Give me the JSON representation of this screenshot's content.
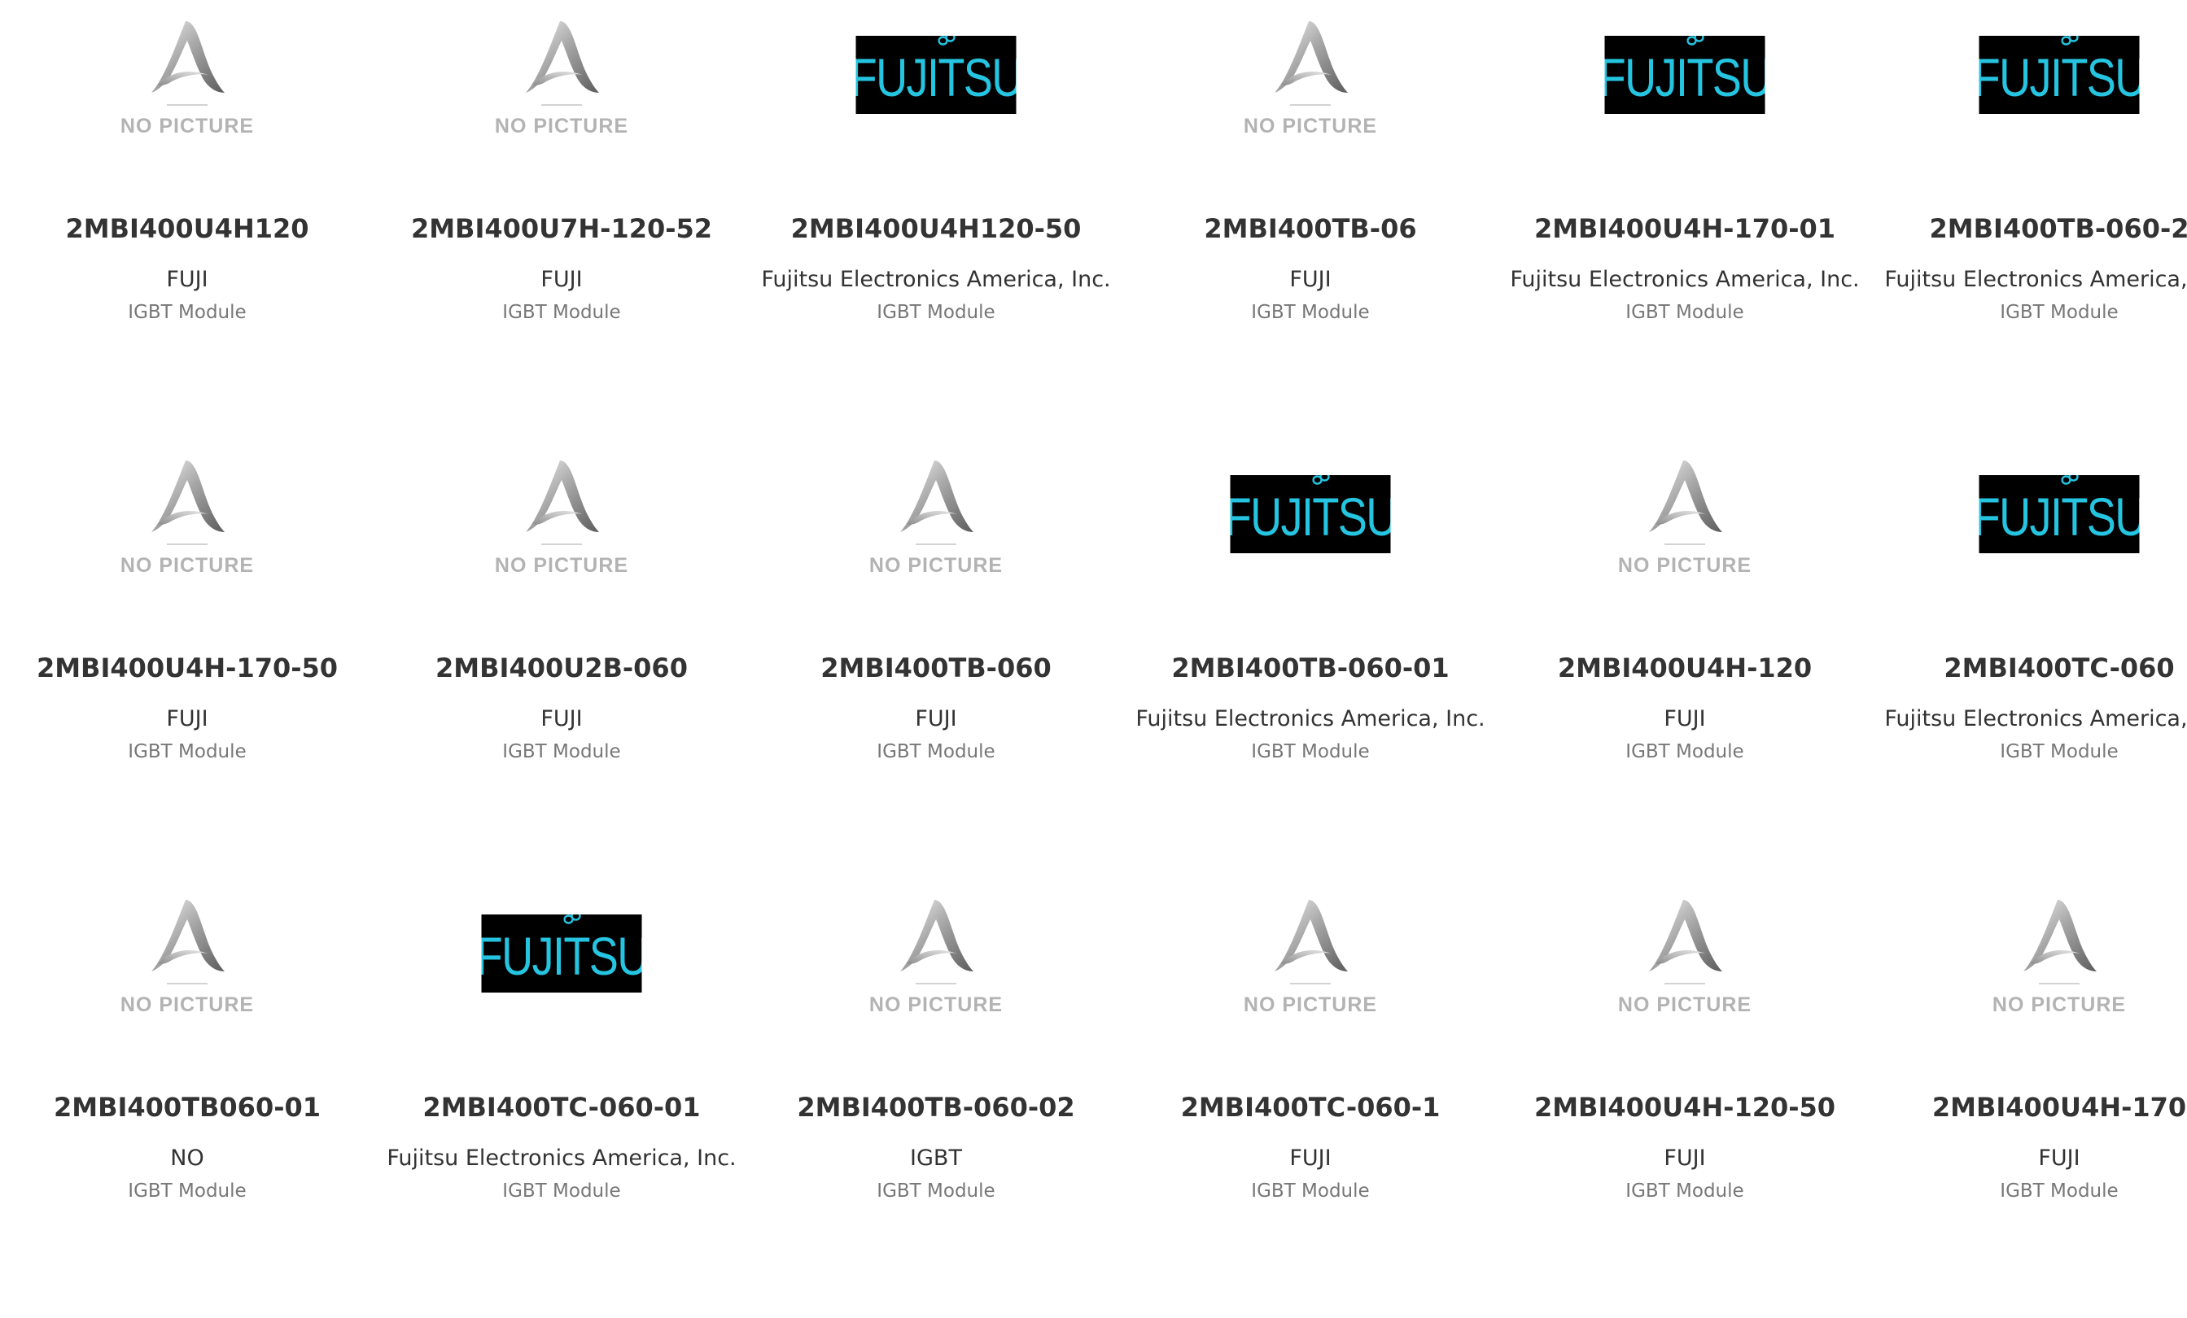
{
  "placeholder_text": "NO PICTURE",
  "logo_text": "FUJITSU",
  "colors": {
    "logo_bg": "#000000",
    "logo_fg": "#25c4e0",
    "title": "#333333",
    "category": "#777777",
    "placeholder": "#b3b3b3"
  },
  "products": [
    {
      "part": "2MBI400U4H120",
      "maker": "FUJI",
      "category": "IGBT Module",
      "image": "no-picture"
    },
    {
      "part": "2MBI400U7H-120-52",
      "maker": "FUJI",
      "category": "IGBT Module",
      "image": "no-picture"
    },
    {
      "part": "2MBI400U4H120-50",
      "maker": "Fujitsu Electronics America, Inc.",
      "category": "IGBT Module",
      "image": "fujitsu-logo"
    },
    {
      "part": "2MBI400TB-06",
      "maker": "FUJI",
      "category": "IGBT Module",
      "image": "no-picture"
    },
    {
      "part": "2MBI400U4H-170-01",
      "maker": "Fujitsu Electronics America, Inc.",
      "category": "IGBT Module",
      "image": "fujitsu-logo"
    },
    {
      "part": "2MBI400TB-060-2",
      "maker": "Fujitsu Electronics America, Inc.",
      "category": "IGBT Module",
      "image": "fujitsu-logo"
    },
    {
      "part": "2MBI400U4H-170-50",
      "maker": "FUJI",
      "category": "IGBT Module",
      "image": "no-picture"
    },
    {
      "part": "2MBI400U2B-060",
      "maker": "FUJI",
      "category": "IGBT Module",
      "image": "no-picture"
    },
    {
      "part": "2MBI400TB-060",
      "maker": "FUJI",
      "category": "IGBT Module",
      "image": "no-picture"
    },
    {
      "part": "2MBI400TB-060-01",
      "maker": "Fujitsu Electronics America, Inc.",
      "category": "IGBT Module",
      "image": "fujitsu-logo"
    },
    {
      "part": "2MBI400U4H-120",
      "maker": "FUJI",
      "category": "IGBT Module",
      "image": "no-picture"
    },
    {
      "part": "2MBI400TC-060",
      "maker": "Fujitsu Electronics America, Inc.",
      "category": "IGBT Module",
      "image": "fujitsu-logo"
    },
    {
      "part": "2MBI400TB060-01",
      "maker": "NO",
      "category": "IGBT Module",
      "image": "no-picture"
    },
    {
      "part": "2MBI400TC-060-01",
      "maker": "Fujitsu Electronics America, Inc.",
      "category": "IGBT Module",
      "image": "fujitsu-logo"
    },
    {
      "part": "2MBI400TB-060-02",
      "maker": "IGBT",
      "category": "IGBT Module",
      "image": "no-picture"
    },
    {
      "part": "2MBI400TC-060-1",
      "maker": "FUJI",
      "category": "IGBT Module",
      "image": "no-picture"
    },
    {
      "part": "2MBI400U4H-120-50",
      "maker": "FUJI",
      "category": "IGBT Module",
      "image": "no-picture"
    },
    {
      "part": "2MBI400U4H-170",
      "maker": "FUJI",
      "category": "IGBT Module",
      "image": "no-picture"
    }
  ]
}
